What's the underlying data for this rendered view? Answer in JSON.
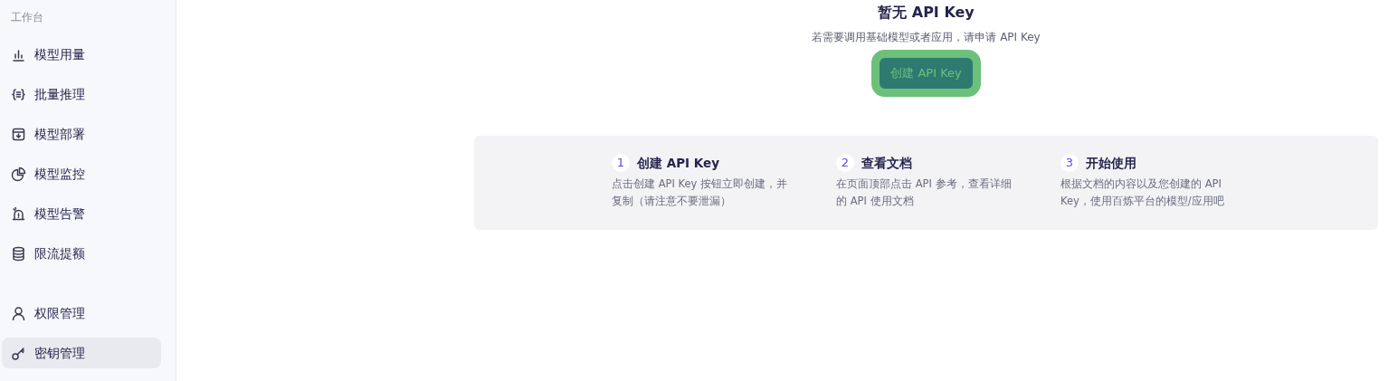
{
  "sidebar": {
    "group_label": "工作台",
    "sections": [
      {
        "items": [
          {
            "label": "模型用量",
            "selected": false
          },
          {
            "label": "批量推理",
            "selected": false
          },
          {
            "label": "模型部署",
            "selected": false
          },
          {
            "label": "模型监控",
            "selected": false
          },
          {
            "label": "模型告警",
            "selected": false
          },
          {
            "label": "限流提额",
            "selected": false
          }
        ]
      },
      {
        "items": [
          {
            "label": "权限管理",
            "selected": false
          },
          {
            "label": "密钥管理",
            "selected": true
          }
        ]
      }
    ]
  },
  "empty_state": {
    "title": "暂无 API Key",
    "description": "若需要调用基础模型或者应用，请申请 API Key",
    "button": "创建 API Key"
  },
  "steps": [
    {
      "number": "1",
      "title": "创建 API Key",
      "description": "点击创建 API Key 按钮立即创建，并复制（请注意不要泄漏）"
    },
    {
      "number": "2",
      "title": "查看文档",
      "description": "在页面顶部点击 API 参考，查看详细的 API 使用文档"
    },
    {
      "number": "3",
      "title": "开始使用",
      "description": "根据文档的内容以及您创建的 API Key，使用百炼平台的模型/应用吧"
    }
  ]
}
